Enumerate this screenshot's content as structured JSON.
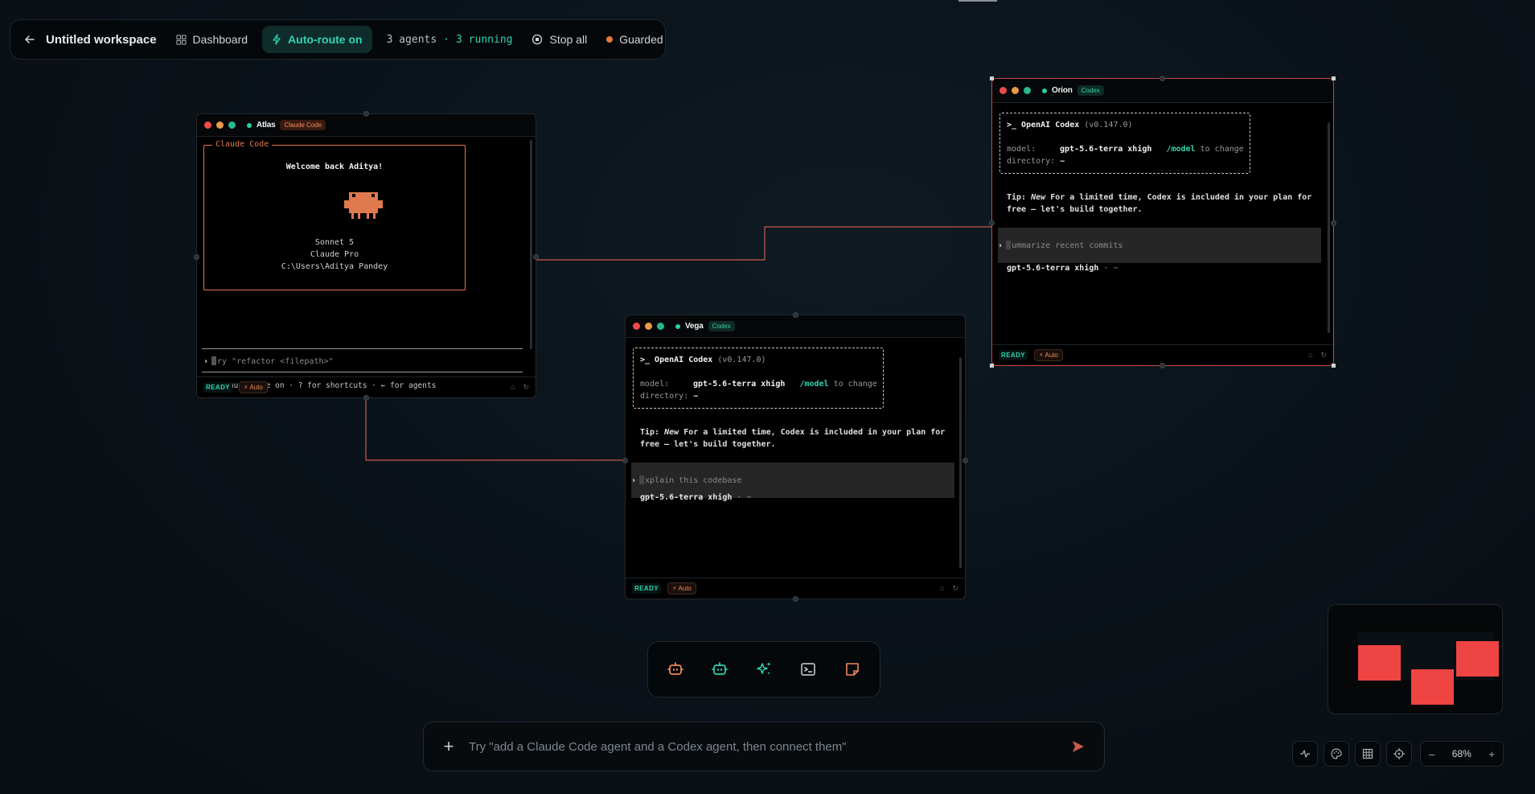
{
  "topbar": {
    "back_icon": "arrow-left-icon",
    "title": "Untitled workspace",
    "dashboard_label": "Dashboard",
    "auto_route_label": "Auto-route on",
    "agents_count": "3 agents",
    "dot_sep": "·",
    "running_count": "3 running",
    "stop_all_label": "Stop all",
    "guarded_label": "Guarded"
  },
  "windows": {
    "atlas": {
      "name": "Atlas",
      "tag": "Claude Code",
      "box_title": "Claude Code",
      "welcome": "Welcome back Aditya!",
      "model": "Sonnet 5",
      "plan": "Claude Pro",
      "path": "C:\\Users\\Aditya Pandey",
      "prompt_first": "T",
      "prompt_rest": "ry \"refactor <filepath>\"",
      "mode_hint": "⏸ manual mode on · ? for shortcuts · ← for agents",
      "status": "READY",
      "auto": "Auto"
    },
    "orion": {
      "name": "Orion",
      "tag": "Codex",
      "header": ">_ OpenAI Codex",
      "version": "(v0.147.0)",
      "model_key": "model:",
      "model_val": "gpt-5.6-terra xhigh",
      "model_cmd": "/model",
      "model_change": "to change",
      "dir_key": "directory:",
      "dir_val": "~",
      "tip_label": "Tip:",
      "tip_new": "New",
      "tip_line1": "For a limited time, Codex is included in your plan for",
      "tip_line2": "free – let's build together.",
      "input_first": "S",
      "input_rest": "ummarize recent commits",
      "model_status": "gpt-5.6-terra xhigh",
      "model_status_suffix": "· ~",
      "status": "READY",
      "auto": "Auto"
    },
    "vega": {
      "name": "Vega",
      "tag": "Codex",
      "header": ">_ OpenAI Codex",
      "version": "(v0.147.0)",
      "model_key": "model:",
      "model_val": "gpt-5.6-terra xhigh",
      "model_cmd": "/model",
      "model_change": "to change",
      "dir_key": "directory:",
      "dir_val": "~",
      "tip_label": "Tip:",
      "tip_new": "New",
      "tip_line1": "For a limited time, Codex is included in your plan for",
      "tip_line2": "free – let's build together.",
      "input_first": "E",
      "input_rest": "xplain this codebase",
      "model_status": "gpt-5.6-terra xhigh",
      "model_status_suffix": "· ~",
      "status": "READY",
      "auto": "Auto"
    }
  },
  "dock": {
    "items": [
      "claude-agent-icon",
      "codex-agent-icon",
      "sparkles-icon",
      "terminal-icon",
      "note-icon"
    ]
  },
  "chat": {
    "placeholder": "Try \"add a Claude Code agent and a Codex agent, then connect them\""
  },
  "controls": {
    "zoom_minus": "–",
    "zoom_level": "68%",
    "zoom_plus": "+"
  },
  "colors": {
    "accent_teal": "#2fd5b0",
    "accent_orange": "#e8763c",
    "selection_red": "#c5484a",
    "minimap_window": "#ef4444"
  }
}
